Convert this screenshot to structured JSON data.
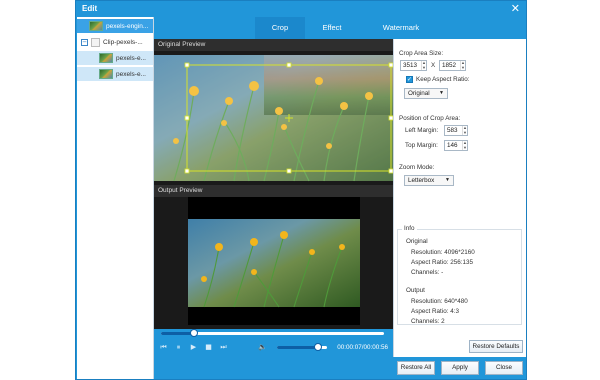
{
  "window": {
    "title": "Edit",
    "close_glyph": "✕"
  },
  "tree": {
    "items": [
      {
        "label": "pexels-engin...",
        "type": "video",
        "selected": true
      },
      {
        "label": "Clip-pexels-...",
        "type": "clip",
        "toggle": "−"
      },
      {
        "label": "pexels-e...",
        "type": "video-child"
      },
      {
        "label": "pexels-e...",
        "type": "video-child"
      }
    ]
  },
  "tabs": [
    {
      "label": "Crop",
      "active": true
    },
    {
      "label": "Effect",
      "active": false
    },
    {
      "label": "Watermark",
      "active": false
    }
  ],
  "preview": {
    "original_label": "Original Preview",
    "output_label": "Output Preview"
  },
  "controls": {
    "seek_progress": 0.15,
    "volume_level": 0.82,
    "timecode": "00:00:07/00:00:56",
    "icons": [
      "skip-back-icon",
      "pause-icon",
      "play-icon",
      "stop-icon",
      "skip-forward-icon",
      "volume-icon"
    ]
  },
  "crop": {
    "crop_area_label": "Crop Area Size:",
    "width": "3513",
    "x_sep": "X",
    "height": "1852",
    "keep_aspect_label": "Keep Aspect Ratio:",
    "keep_aspect_checked": true,
    "aspect_value": "Original",
    "position_label": "Position of Crop Area:",
    "left_margin_label": "Left Margin:",
    "left_margin": "583",
    "top_margin_label": "Top Margin:",
    "top_margin": "146",
    "zoom_label": "Zoom Mode:",
    "zoom_value": "Letterbox"
  },
  "info": {
    "title": "Info",
    "original_heading": "Original",
    "orig_resolution": "Resolution: 4096*2160",
    "orig_aspect": "Aspect Ratio: 256:135",
    "orig_channels": "Channels: -",
    "output_heading": "Output",
    "out_resolution": "Resolution: 640*480",
    "out_aspect": "Aspect Ratio: 4:3",
    "out_channels": "Channels: 2"
  },
  "buttons": {
    "restore_defaults": "Restore Defaults",
    "restore_all": "Restore All",
    "apply": "Apply",
    "close": "Close"
  },
  "colors": {
    "accent": "#2196d9",
    "crop_frame": "#d6e22a"
  }
}
